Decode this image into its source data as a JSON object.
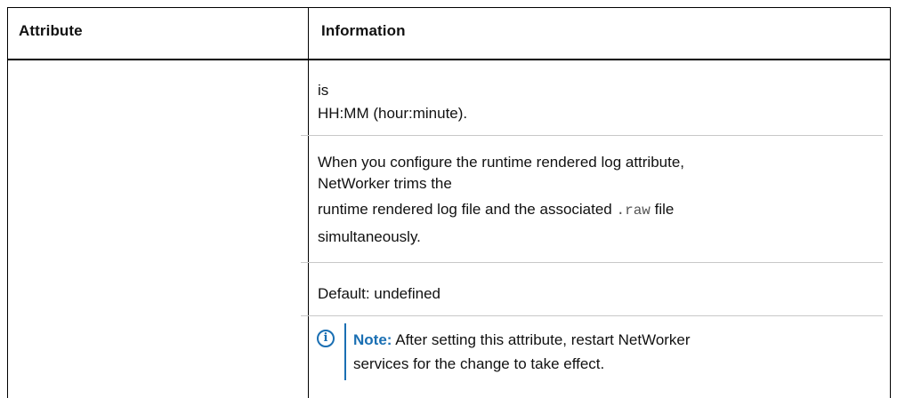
{
  "table": {
    "headers": {
      "attribute": "Attribute",
      "information": "Information"
    },
    "info": {
      "line_is": "is",
      "line_format": "HH:MM (hour:minute).",
      "para_line1": "When you configure the runtime rendered log attribute,",
      "para_line2": "NetWorker trims the",
      "para_line3_before": "runtime rendered log file and the associated ",
      "para_line3_code": ".raw",
      "para_line3_after": " file",
      "para_line4": "simultaneously.",
      "default_text": "Default: undefined",
      "note_label": "Note:",
      "note_line1": " After setting this attribute, restart NetWorker",
      "note_line2": "services for the change to take effect."
    }
  },
  "colors": {
    "note_accent": "#1a6fb3"
  },
  "icons": {
    "note": "info-circle-icon"
  }
}
